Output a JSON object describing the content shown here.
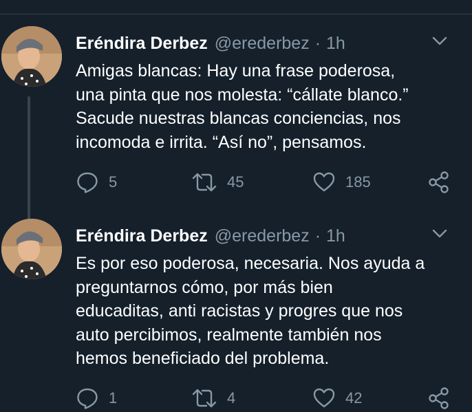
{
  "tweets": [
    {
      "author_name": "Eréndira Derbez",
      "handle": "@erederbez",
      "separator": "·",
      "time": "1h",
      "text": "Amigas blancas: Hay una frase poderosa,\nuna pinta que nos molesta: “cállate blanco.”\nSacude nuestras blancas conciencias, nos\nincomoda e irrita. “Así no”, pensamos.",
      "replies": "5",
      "retweets": "45",
      "likes": "185"
    },
    {
      "author_name": "Eréndira Derbez",
      "handle": "@erederbez",
      "separator": "·",
      "time": "1h",
      "text": "Es por eso poderosa, necesaria. Nos ayuda a\npreguntarnos cómo, por más bien\neducaditas, anti racistas y progres que nos\nauto percibimos, realmente también nos\nhemos beneficiado del problema.",
      "replies": "1",
      "retweets": "4",
      "likes": "42"
    }
  ],
  "icons": {
    "reply": "speech-bubble-icon",
    "retweet": "retweet-arrows-icon",
    "like": "heart-icon",
    "share": "share-nodes-icon",
    "menu": "chevron-down-icon"
  },
  "colors": {
    "background": "#15202b",
    "primary_text": "#ffffff",
    "secondary_text": "#8899a6",
    "divider": "#38444d"
  }
}
